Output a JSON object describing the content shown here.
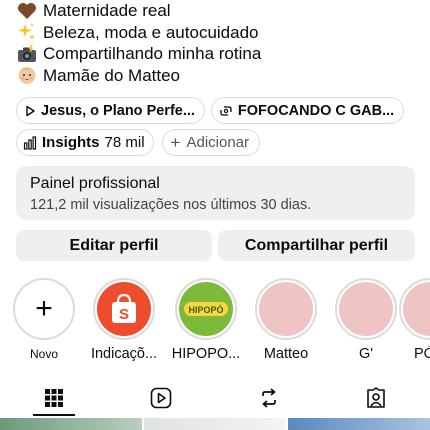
{
  "bio": {
    "lines": [
      {
        "emoji": "brown-heart",
        "text": "Maternidade real"
      },
      {
        "emoji": "sparkles",
        "text": "Beleza, moda e autocuidado"
      },
      {
        "emoji": "camera-flash",
        "text": "Compartilhando minha rotina"
      },
      {
        "emoji": "baby",
        "text": "Mamãe do Matteo"
      }
    ]
  },
  "links": {
    "music_label": "Jesus, o Plano Perfe...",
    "threads_label": "FOFOCANDO C GAB..."
  },
  "insights": {
    "label": "Insights",
    "value": "78 mil",
    "add_label": "Adicionar"
  },
  "painel": {
    "title": "Painel profissional",
    "subtitle": "121,2 mil visualizações nos últimos 30 dias."
  },
  "actions": {
    "edit_label": "Editar perfil",
    "share_label": "Compartilhar perfil"
  },
  "highlights": {
    "new_label": "Novo",
    "items": [
      {
        "label": "Indicaçõ...",
        "cover": "shopee"
      },
      {
        "label": "HIPOPO...",
        "cover": "hipopo"
      },
      {
        "label": "Matteo",
        "cover": "pink"
      },
      {
        "label": "G'",
        "cover": "pink"
      },
      {
        "label": "PÓ",
        "cover": "pink"
      }
    ],
    "logo_text": {
      "hipopo": "HIPOPÓ"
    }
  },
  "tabs": [
    {
      "name": "grid",
      "icon": "grid-icon",
      "active": true
    },
    {
      "name": "reels",
      "icon": "reels-icon",
      "active": false
    },
    {
      "name": "reposts",
      "icon": "repost-icon",
      "active": false
    },
    {
      "name": "tagged",
      "icon": "tagged-icon",
      "active": false
    }
  ],
  "colors": {
    "shopee": "#ee4d2d",
    "hipopo_bg": "#7dba3a",
    "pink_cover": "#efc4c4",
    "chip_border": "#dbdbdb",
    "panel_bg": "#efefef"
  }
}
